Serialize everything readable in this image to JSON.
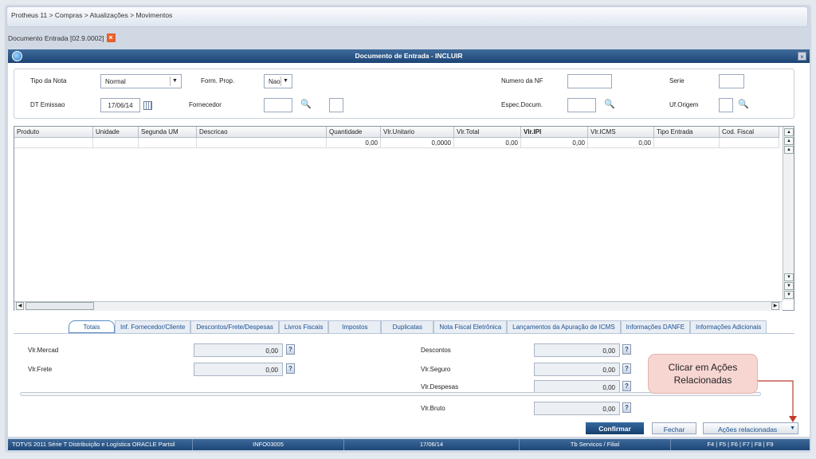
{
  "breadcrumb": "Protheus 11 > Compras  > Atualizações > Movimentos",
  "doc_tab": {
    "label": "Documento Entrada [02.9.0002]",
    "close": "×"
  },
  "window": {
    "title": "Documento de Entrada - INCLUIR",
    "close": "×"
  },
  "form": {
    "tipo_nota_label": "Tipo da Nota",
    "tipo_nota_value": "Normal",
    "form_prop_label": "Form. Prop.",
    "form_prop_value": "Nao",
    "numero_nf_label": "Numero da NF",
    "serie_label": "Serie",
    "dt_emissao_label": "DT Emissao",
    "dt_emissao_value": "17/06/14",
    "fornecedor_label": "Fornecedor",
    "espec_label": "Espec.Docum.",
    "uf_label": "Uf.Origem"
  },
  "grid": {
    "headers": [
      "Produto",
      "Unidade",
      "Segunda UM",
      "Descricao",
      "Quantidade",
      "Vlr.Unitario",
      "Vlr.Total",
      "Vlr.IPI",
      "Vlr.ICMS",
      "Tipo Entrada",
      "Cod. Fiscal"
    ],
    "row": [
      "",
      "",
      "",
      "",
      "0,00",
      "0,0000",
      "0,00",
      "0,00",
      "0,00",
      "",
      ""
    ]
  },
  "tabs": [
    "Totais",
    "Inf. Fornecedor/Cliente",
    "Descontos/Frete/Despesas",
    "Livros Fiscais",
    "Impostos",
    "Duplicatas",
    "Nota Fiscal Eletrônica",
    "Lançamentos da Apuração de ICMS",
    "Informações DANFE",
    "Informações Adicionais"
  ],
  "totals": {
    "vlr_mercad_label": "Vlr.Mercad",
    "vlr_mercad_value": "0,00",
    "vlr_frete_label": "Vlr.Frete",
    "vlr_frete_value": "0,00",
    "descontos_label": "Descontos",
    "descontos_value": "0,00",
    "vlr_seguro_label": "Vlr.Seguro",
    "vlr_seguro_value": "0,00",
    "vlr_despesas_label": "Vlr.Despesas",
    "vlr_despesas_value": "0,00",
    "vlr_bruto_label": "Vlr.Bruto",
    "vlr_bruto_value": "0,00",
    "help": "?"
  },
  "buttons": {
    "confirm": "Confirmar",
    "close": "Fechar",
    "actions": "Ações relacionadas"
  },
  "callout": {
    "line1": "Clicar em Ações",
    "line2": "Relacionadas"
  },
  "status": [
    "TOTVS 2011 Série T Distribuição e Logística ORACLE Partsil",
    "INFO03005",
    "17/06/14",
    "Tb Servicos / Filial",
    "F4 | F5 | F6 | F7 | F8 | F9"
  ],
  "colors": {
    "accent": "#1b4474",
    "callout": "#f7d6d2",
    "arrow": "#c0392b"
  }
}
